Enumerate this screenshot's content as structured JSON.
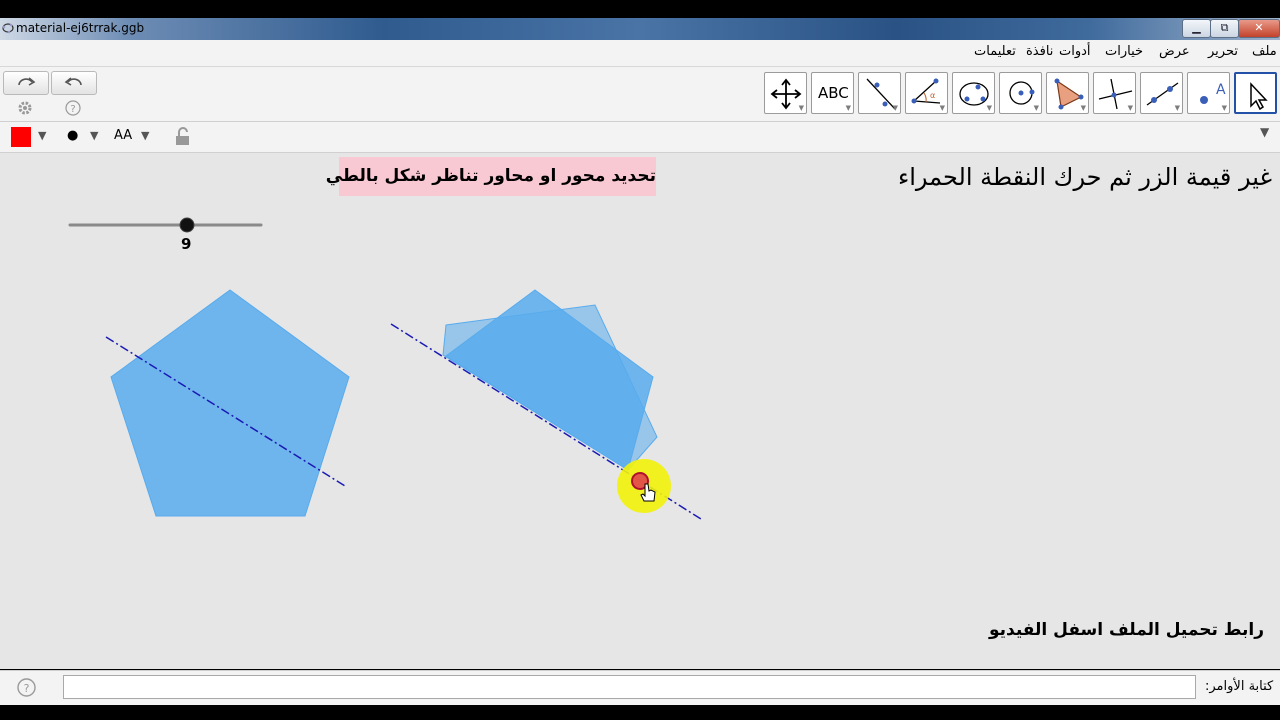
{
  "window": {
    "title": "material-ej6trrak.ggb",
    "minimize": "▁",
    "maximize": "⧉",
    "close": "✕"
  },
  "menu": {
    "items": [
      "ملف",
      "تحرير",
      "عرض",
      "خيارات",
      "أدوات",
      "نافذة",
      "تعليمات"
    ]
  },
  "toolbar": {
    "text_tool_label": "ABC",
    "text_label_tool_glyph": "A"
  },
  "stylebar": {
    "color": "#ff0000",
    "point_glyph": "●",
    "text_size_glyph": "AA"
  },
  "canvas": {
    "hint_box_text": "تحديد محور او محاور تناظر شكل بالطي",
    "instruction_text": "غير قيمة الزر ثم حرك النقطة الحمراء",
    "download_note": "رابط تحميل الملف اسفل الفيديو",
    "slider_value": "9",
    "shape_fill": "#58abed",
    "axis_color": "#1a1ab4"
  },
  "input_bar": {
    "label": "كتابة الأوامر:",
    "value": ""
  }
}
